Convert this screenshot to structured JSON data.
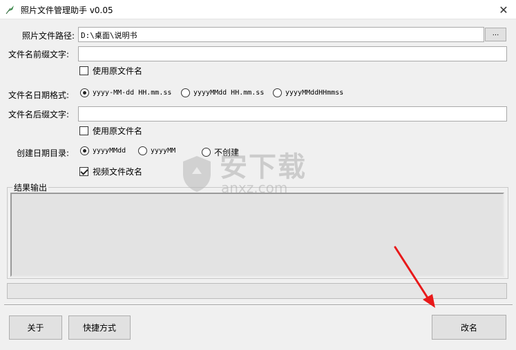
{
  "window": {
    "title": "照片文件管理助手 v0.05",
    "close_glyph": "✕",
    "app_icon": "feather-icon"
  },
  "path": {
    "label": "照片文件路径:",
    "value": "D:\\桌面\\说明书",
    "browse_label": "..."
  },
  "prefix": {
    "label": "文件名前缀文字:",
    "value": "",
    "use_original_label": "使用原文件名",
    "use_original_checked": false
  },
  "date_format": {
    "label": "文件名日期格式:",
    "options": [
      "yyyy-MM-dd HH.mm.ss",
      "yyyyMMdd HH.mm.ss",
      "yyyyMMddHHmmss"
    ],
    "selected": 0
  },
  "suffix": {
    "label": "文件名后缀文字:",
    "value": "",
    "use_original_label": "使用原文件名",
    "use_original_checked": false
  },
  "dir_date": {
    "label": "创建日期目录:",
    "options": [
      "yyyyMMdd",
      "yyyyMM",
      "不创建"
    ],
    "selected": 0
  },
  "video_rename": {
    "label": "视频文件改名",
    "checked": true
  },
  "output": {
    "title": "结果输出",
    "text": ""
  },
  "buttons": {
    "about": "关于",
    "shortcut": "快捷方式",
    "rename": "改名"
  },
  "watermark": {
    "main": "安下载",
    "sub": "anxz.com"
  },
  "colors": {
    "arrow": "#e8191a",
    "watermark": "#b0b0b0"
  }
}
